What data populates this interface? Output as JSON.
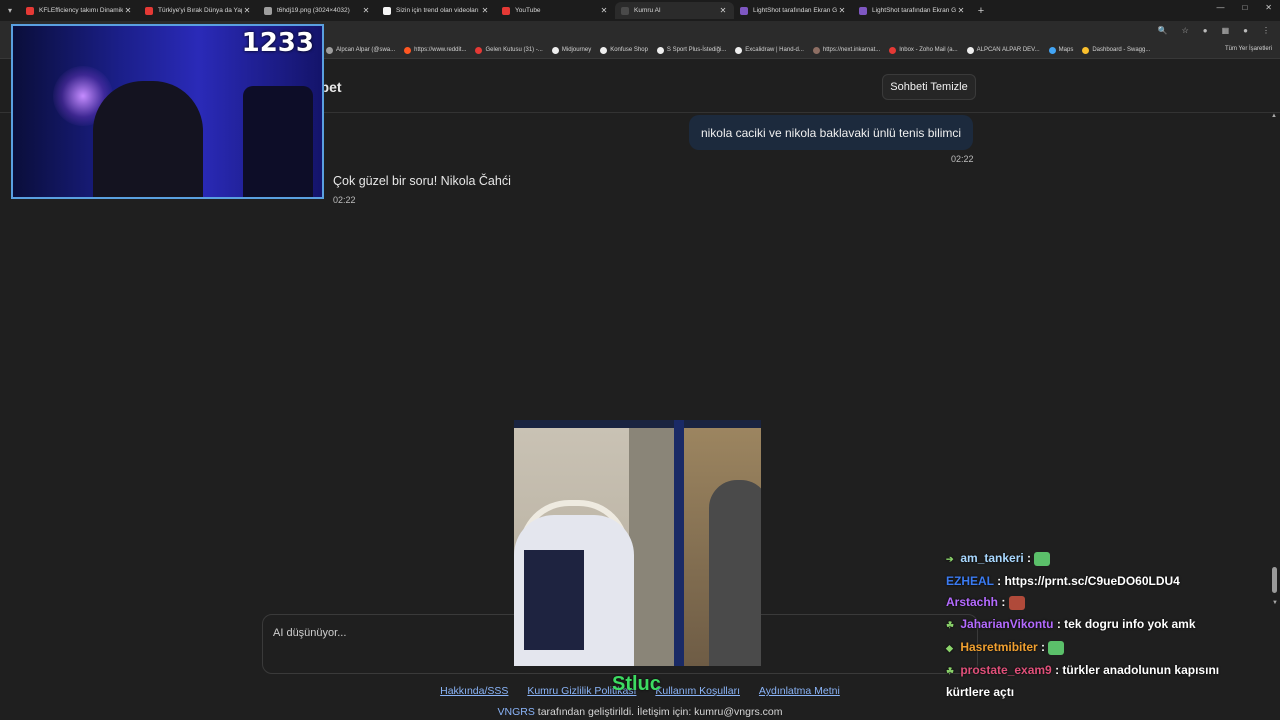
{
  "browser": {
    "tabs": [
      {
        "title": "KFLEfficiency takımı Dinamik Sü",
        "favicon_color": "#e53935",
        "active": false
      },
      {
        "title": "Türkiye'yi Bırak Dünya da Yapa",
        "favicon_color": "#e53935",
        "active": false
      },
      {
        "title": "t6hdj19.png (3024×4032)",
        "favicon_color": "#9e9e9e",
        "active": false
      },
      {
        "title": "Sizin için trend olan videoları iz",
        "favicon_color": "#f5f5f5",
        "active": false
      },
      {
        "title": "YouTube",
        "favicon_color": "#e53935",
        "active": false
      },
      {
        "title": "Kumru AI",
        "favicon_color": "#4a4a4a",
        "active": true
      },
      {
        "title": "LightShot tarafından Ekran Görü",
        "favicon_color": "#7e57c2",
        "active": false
      },
      {
        "title": "LightShot tarafından Ekran Görü",
        "favicon_color": "#7e57c2",
        "active": false
      }
    ],
    "new_tab": "+",
    "bookmarks": [
      {
        "label": "Alpcan Alpar (@swa...",
        "color": "#9e9e9e"
      },
      {
        "label": "https://www.reddit...",
        "color": "#ff5722"
      },
      {
        "label": "Gelen Kutusu (31) -...",
        "color": "#e53935"
      },
      {
        "label": "Midjourney",
        "color": "#eeeeee"
      },
      {
        "label": "Konfuse Shop",
        "color": "#eeeeee"
      },
      {
        "label": "S Sport Plus-İstediği...",
        "color": "#eeeeee"
      },
      {
        "label": "Excalidraw | Hand-d...",
        "color": "#eeeeee"
      },
      {
        "label": "https://next.inkarnat...",
        "color": "#8d6e63"
      },
      {
        "label": "Inbox - Zoho Mail (a...",
        "color": "#e53935"
      },
      {
        "label": "ALPCAN ALPAR DEV...",
        "color": "#eeeeee"
      },
      {
        "label": "Maps",
        "color": "#42a5f5"
      },
      {
        "label": "Dashboard - Swagg...",
        "color": "#fbc02d"
      }
    ],
    "bookmarks_right": "Tüm Yer İşaretleri"
  },
  "app": {
    "header_title": "hbet",
    "clear_button": "Sohbeti Temizle",
    "messages": {
      "user_text": "nikola caciki ve nikola baklavaki ünlü tenis bilimci",
      "user_time": "02:22",
      "ai_text": "Çok güzel bir soru! Nikola Čahći",
      "ai_time": "02:22"
    },
    "input_placeholder": "AI düşünüyor...",
    "footer": {
      "links": [
        "Hakkında/SSS",
        "Kumru Gizlilik Politikası",
        "Kullanım Koşulları",
        "Aydınlatma Metni"
      ],
      "brand": "VNGRS",
      "note": " tarafından geliştirildi. İletişim için: kumru@vngrs.com"
    }
  },
  "overlay": {
    "counter": "1233",
    "clip_text": "Stluc",
    "chat": [
      {
        "user": "am_tankeri",
        "user_color": "#a9d8ff",
        "sep": " :",
        "text": "",
        "emote_color": "#5bc06a",
        "badge": "➔"
      },
      {
        "user": "EZHEAL",
        "user_color": "#3b7bf2",
        "sep": " :",
        "text": " https://prnt.sc/C9ueDO60LDU4",
        "emote_color": "",
        "badge": ""
      },
      {
        "user": "Arstachh",
        "user_color": "#b46bff",
        "sep": " :",
        "text": "",
        "emote_color": "#b04a3a",
        "badge": ""
      },
      {
        "user": "JaharianVikontu",
        "user_color": "#b46bff",
        "sep": " :",
        "text": " tek dogru info yok amk",
        "emote_color": "",
        "badge": "☘"
      },
      {
        "user": "Hasretmibiter",
        "user_color": "#f0a030",
        "sep": " :",
        "text": "",
        "emote_color": "#5bc06a",
        "badge": "◆"
      },
      {
        "user": "prostate_exam9",
        "user_color": "#e0507a",
        "sep": " :",
        "text": " türkler anadolunun kapısını kürtlere açtı",
        "emote_color": "",
        "badge": "☘"
      }
    ]
  }
}
